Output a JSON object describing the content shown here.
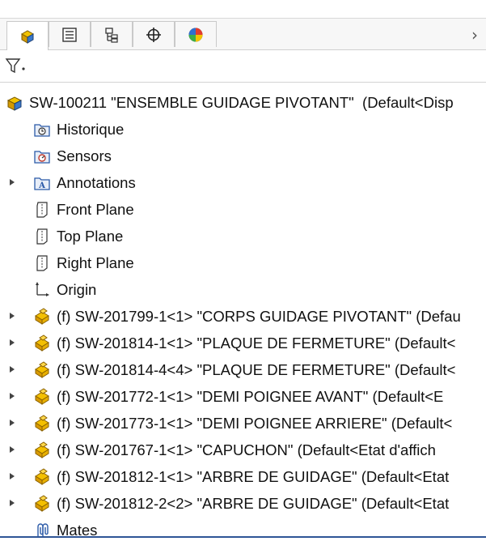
{
  "tabs": [
    {
      "icon": "feature-manager-icon",
      "active": true
    },
    {
      "icon": "property-manager-icon",
      "active": false
    },
    {
      "icon": "configuration-manager-icon",
      "active": false
    },
    {
      "icon": "dimxpert-manager-icon",
      "active": false
    },
    {
      "icon": "display-manager-icon",
      "active": false
    }
  ],
  "tab_overflow_icon": "chevron-right-icon",
  "filter": {
    "icon": "funnel-filter-icon"
  },
  "tree": {
    "root": {
      "label": "SW-100211 \"ENSEMBLE GUIDAGE PIVOTANT\"  (Default<Disp",
      "icon": "assembly-icon"
    },
    "folders": [
      {
        "label": "Historique",
        "icon": "history-folder-icon",
        "expandable": false
      },
      {
        "label": "Sensors",
        "icon": "sensors-folder-icon",
        "expandable": false
      },
      {
        "label": "Annotations",
        "icon": "annotations-folder-icon",
        "expandable": true
      },
      {
        "label": "Front Plane",
        "icon": "plane-icon",
        "expandable": false
      },
      {
        "label": "Top Plane",
        "icon": "plane-icon",
        "expandable": false
      },
      {
        "label": "Right Plane",
        "icon": "plane-icon",
        "expandable": false
      },
      {
        "label": "Origin",
        "icon": "origin-icon",
        "expandable": false
      }
    ],
    "components": [
      {
        "label": "(f) SW-201799-1<1> \"CORPS GUIDAGE PIVOTANT\" (Defau"
      },
      {
        "label": "(f) SW-201814-1<1> \"PLAQUE DE FERMETURE\" (Default<"
      },
      {
        "label": "(f) SW-201814-4<4> \"PLAQUE DE FERMETURE\" (Default<"
      },
      {
        "label": "(f) SW-201772-1<1> \"DEMI POIGNEE AVANT\" (Default<E"
      },
      {
        "label": "(f) SW-201773-1<1> \"DEMI POIGNEE ARRIERE\" (Default<"
      },
      {
        "label": "(f) SW-201767-1<1> \"CAPUCHON\" (Default<Etat d'affich"
      },
      {
        "label": "(f) SW-201812-1<1> \"ARBRE DE GUIDAGE\" (Default<Etat"
      },
      {
        "label": "(f) SW-201812-2<2> \"ARBRE DE GUIDAGE\" (Default<Etat"
      }
    ],
    "mates": {
      "label": "Mates",
      "icon": "mates-icon"
    }
  },
  "colors": {
    "accent_line": "#2f5597",
    "part_yellow": "#e8b400",
    "folder_blue": "#2b5aa8"
  }
}
